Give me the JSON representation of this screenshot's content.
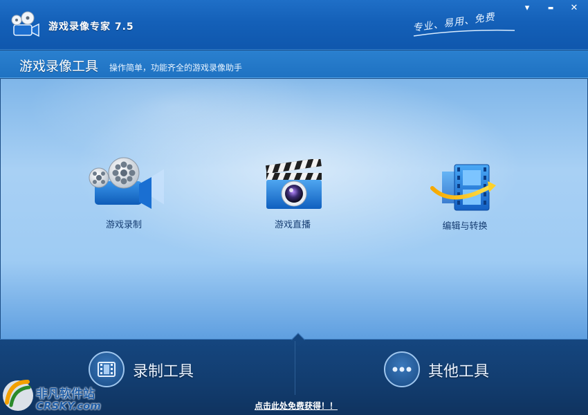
{
  "app": {
    "title": "游戏录像专家 7.5",
    "slogan": "专业、易用、免费"
  },
  "window_controls": {
    "menu_glyph": "▾",
    "minimize_glyph": "▬",
    "close_glyph": "✕"
  },
  "subheader": {
    "title": "游戏录像工具",
    "description": "操作简单，功能齐全的游戏录像助手"
  },
  "tools": [
    {
      "label": "游戏录制",
      "icon": "film-camera-icon"
    },
    {
      "label": "游戏直播",
      "icon": "clapperboard-camera-icon"
    },
    {
      "label": "编辑与转换",
      "icon": "film-convert-icon"
    }
  ],
  "bottom": {
    "record_tools_label": "录制工具",
    "other_tools_label": "其他工具"
  },
  "footer": {
    "link_text": "点击此处免费获得！！"
  },
  "watermark": {
    "line1": "非凡软件站",
    "line2": "CRSKY.com"
  },
  "colors": {
    "titlebar": "#1460b8",
    "main_bg": "#a8d0f4",
    "bottom_bg": "#123c6e",
    "label_text": "#163d72"
  }
}
